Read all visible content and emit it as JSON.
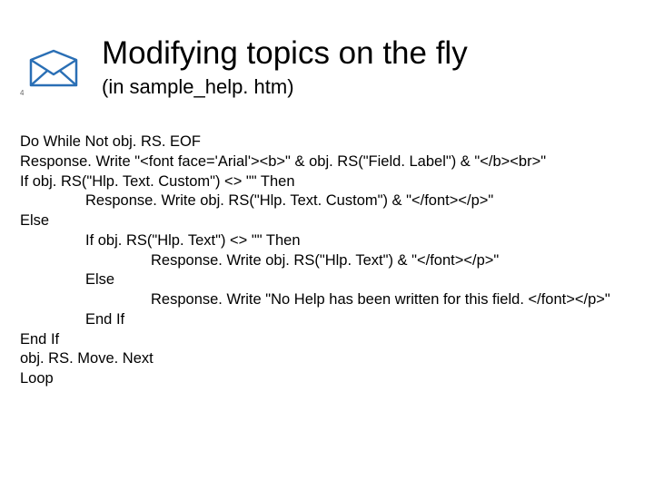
{
  "page_number": "4",
  "header": {
    "title": "Modifying topics on the fly",
    "subtitle": "(in sample_help. htm)"
  },
  "code": {
    "l1": "Do While Not obj. RS. EOF",
    "l2": "Response. Write \"<font face='Arial'><b>\" & obj. RS(\"Field. Label\") & \"</b><br>\"",
    "l3": "If obj. RS(\"Hlp. Text. Custom\") <> \"\" Then",
    "l4": "Response. Write obj. RS(\"Hlp. Text. Custom\") & \"</font></p>\"",
    "l5": "Else",
    "l6": "If obj. RS(\"Hlp. Text\") <> \"\" Then",
    "l7": "Response. Write obj. RS(\"Hlp. Text\") & \"</font></p>\"",
    "l8": "Else",
    "l9": "Response. Write \"No Help has been written for this field. </font></p>\"",
    "l10": "End If",
    "l11": "End If",
    "l12": "obj. RS. Move. Next",
    "l13": "Loop"
  }
}
